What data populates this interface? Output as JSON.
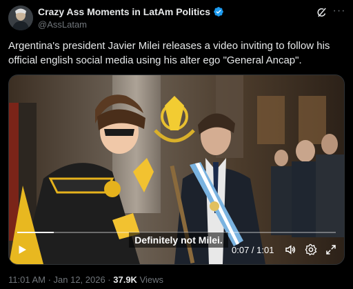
{
  "author": {
    "display_name": "Crazy Ass Moments in LatAm Politics",
    "handle": "@AssLatam",
    "verified_color": "#1d9bf0"
  },
  "tweet": {
    "text": "Argentina's president Javier Milei releases a video inviting to follow his official english social media using his alter ego \"General Ancap\"."
  },
  "video": {
    "caption": "Definitely not Milei.",
    "time": "0:07 / 1:01",
    "progress": 0.115,
    "controls": [
      "play-icon",
      "volume-icon",
      "settings-icon",
      "fullscreen-icon"
    ]
  },
  "meta": {
    "timestamp": "11:01 AM · Jan 12, 2026 · ",
    "views_count": "37.9K",
    "views_label": " Views"
  },
  "icons": {
    "grok": "grok-icon",
    "more": "more-icon"
  }
}
